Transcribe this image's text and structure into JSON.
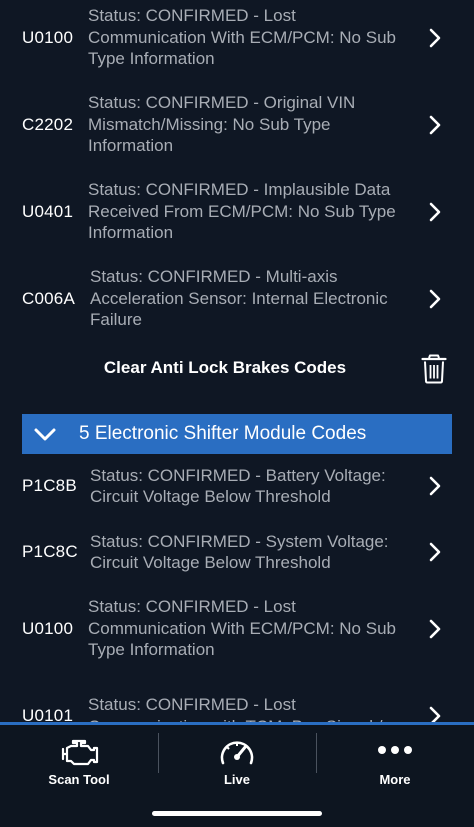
{
  "codes": [
    {
      "id": "U0100",
      "desc": "Status: CONFIRMED - Lost Communication With ECM/PCM: No Sub Type Information"
    },
    {
      "id": "C2202",
      "desc": "Status: CONFIRMED - Original  VIN Mismatch/Missing: No Sub Type Information"
    },
    {
      "id": "U0401",
      "desc": "Status: CONFIRMED - Implausible Data Received From ECM/PCM: No Sub Type Information"
    },
    {
      "id": "C006A",
      "desc": "Status: CONFIRMED - Multi-axis Acceleration Sensor: Internal Electronic Failure"
    }
  ],
  "clear_label": "Clear Anti Lock Brakes Codes",
  "section_title": "5 Electronic Shifter Module Codes",
  "shifter_codes": [
    {
      "id": "P1C8B",
      "desc": "Status: CONFIRMED - Battery Voltage: Circuit Voltage Below Threshold"
    },
    {
      "id": "P1C8C",
      "desc": "Status: CONFIRMED - System Voltage: Circuit Voltage Below Threshold"
    },
    {
      "id": "U0100",
      "desc": "Status: CONFIRMED - Lost Communication With ECM/PCM: No Sub Type Information"
    },
    {
      "id": "U0101",
      "desc": "Status: CONFIRMED - Lost Communication with TCM: Bus Signal /"
    }
  ],
  "tabs": [
    {
      "label": "Scan Tool",
      "icon": "engine-icon"
    },
    {
      "label": "Live",
      "icon": "gauge-icon"
    },
    {
      "label": "More",
      "icon": "more-dots-icon"
    }
  ],
  "colors": {
    "background": "#0f1724",
    "accent": "#2a6ec2",
    "desc_text": "#a8adb5"
  }
}
